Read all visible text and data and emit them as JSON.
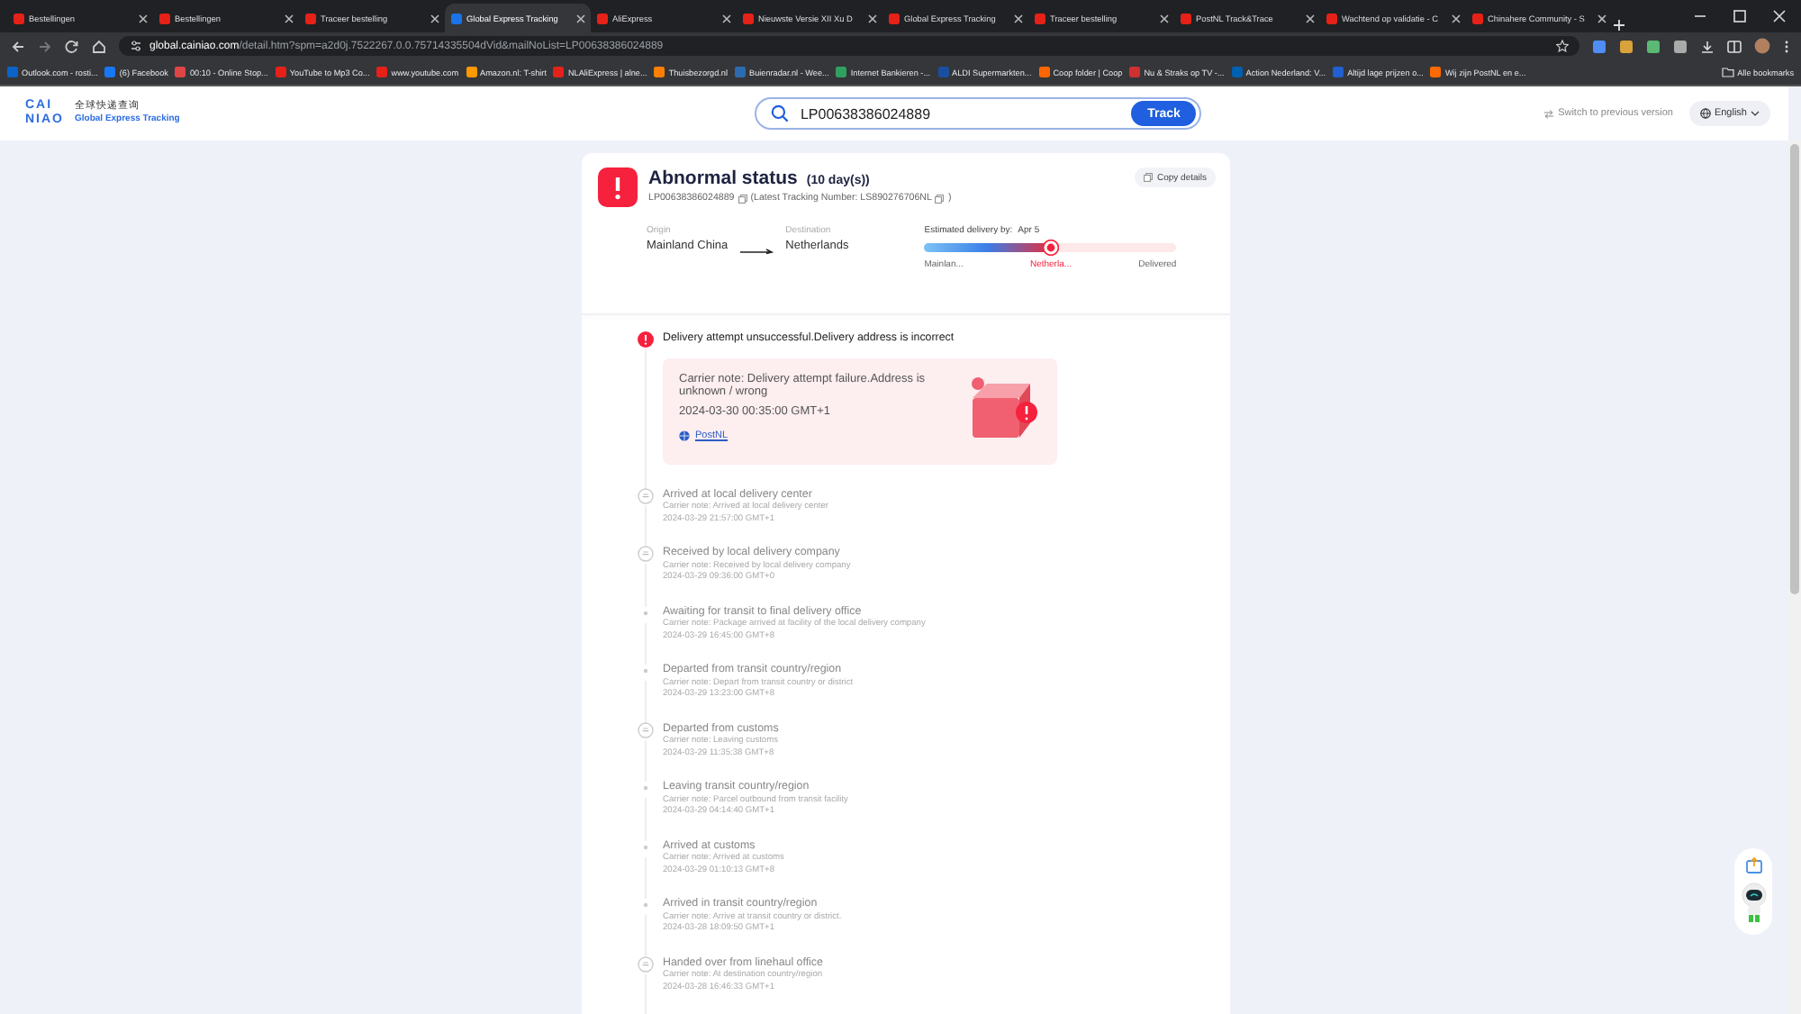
{
  "browser": {
    "tabs": [
      {
        "title": "Bestellingen",
        "selected": false
      },
      {
        "title": "Bestellingen",
        "selected": false
      },
      {
        "title": "Traceer bestelling",
        "selected": false
      },
      {
        "title": "Global Express Tracking",
        "selected": true
      },
      {
        "title": "AliExpress",
        "selected": false
      },
      {
        "title": "Nieuwste Versie XII Xu D",
        "selected": false
      },
      {
        "title": "Global Express Tracking",
        "selected": false
      },
      {
        "title": "Traceer bestelling",
        "selected": false
      },
      {
        "title": "PostNL Track&Trace",
        "selected": false
      },
      {
        "title": "Wachtend op validatie - C",
        "selected": false
      },
      {
        "title": "Chinahere Community - S",
        "selected": false
      }
    ],
    "url_host": "global.cainiao.com",
    "url_path": "/detail.htm?spm=a2d0j.7522267.0.0.75714335504dVid&mailNoList=LP00638386024889",
    "bookmarks": [
      "Outlook.com - rosti...",
      "(6) Facebook",
      "00:10 - Online Stop...",
      "YouTube to Mp3 Co...",
      "www.youtube.com",
      "Amazon.nl: T-shirt",
      "NLAliExpress | alne...",
      "Thuisbezorgd.nl",
      "Buienradar.nl - Wee...",
      "Internet Bankieren -...",
      "ALDI Supermarkten...",
      "Coop folder | Coop",
      "Nu & Straks op TV -...",
      "Action Nederland: V...",
      "Altijd lage prijzen o...",
      "Wij zijn PostNL en e..."
    ],
    "all_bookmarks": "Alle bookmarks"
  },
  "header": {
    "logo_lines": [
      "CAI",
      "NIAO"
    ],
    "subtitle_cn": "全球快递查询",
    "subtitle_en": "Global Express Tracking",
    "search_value": "LP00638386024889",
    "track_button": "Track",
    "switch_link": "Switch to previous version",
    "language": "English"
  },
  "card": {
    "status_title": "Abnormal status",
    "duration": "(10 day(s))",
    "tracking_number": "LP00638386024889",
    "latest_text": "(Latest Tracking Number: LS890276706NL",
    "latest_close": ")",
    "copy_button": "Copy details",
    "origin_label": "Origin",
    "origin": "Mainland China",
    "destination_label": "Destination",
    "destination": "Netherlands",
    "estimate_label": "Estimated delivery by:",
    "estimate": "Apr 5",
    "progress": {
      "level": 0.5,
      "stages": [
        {
          "label": "Mainlan...",
          "selected": false
        },
        {
          "label": "Netherla...",
          "selected": true
        },
        {
          "label": "Delivered",
          "selected": false
        }
      ]
    },
    "latest_event": {
      "kind": "alert",
      "title": "Delivery attempt unsuccessful.Delivery address is incorrect",
      "note": "Carrier note: Delivery attempt failure.Address is unknown / wrong",
      "time": "2024-03-30 00:35:00 GMT+1",
      "carrier": "PostNL"
    },
    "events": [
      {
        "kind": "circle",
        "title": "Arrived at local delivery center",
        "note": "Carrier note: Arrived at local delivery center",
        "time": "2024-03-29 21:57:00 GMT+1"
      },
      {
        "kind": "circle",
        "title": "Received by local delivery company",
        "note": "Carrier note: Received by local delivery company",
        "time": "2024-03-29 09:36:00 GMT+0"
      },
      {
        "kind": "dot",
        "title": "Awaiting for transit to final delivery office",
        "note": "Carrier note: Package arrived at facility of the local delivery company",
        "time": "2024-03-29 16:45:00 GMT+8"
      },
      {
        "kind": "dot",
        "title": "Departed from transit country/region",
        "note": "Carrier note: Depart from transit country or district",
        "time": "2024-03-29 13:23:00 GMT+8"
      },
      {
        "kind": "circle",
        "title": "Departed from customs",
        "note": "Carrier note: Leaving customs",
        "time": "2024-03-29 11:35:38 GMT+8"
      },
      {
        "kind": "dot",
        "title": "Leaving transit country/region",
        "note": "Carrier note: Parcel outbound from transit facility",
        "time": "2024-03-29 04:14:40 GMT+1"
      },
      {
        "kind": "dot",
        "title": "Arrived at customs",
        "note": "Carrier note: Arrived at customs",
        "time": "2024-03-29 01:10:13 GMT+8"
      },
      {
        "kind": "dot",
        "title": "Arrived in transit country/region",
        "note": "Carrier note: Arrive at transit country or district.",
        "time": "2024-03-28 18:09:50 GMT+1"
      },
      {
        "kind": "circle",
        "title": "Handed over from linehaul office",
        "note": "Carrier note: At destination country/region",
        "time": "2024-03-28 16:46:33 GMT+1"
      }
    ]
  }
}
